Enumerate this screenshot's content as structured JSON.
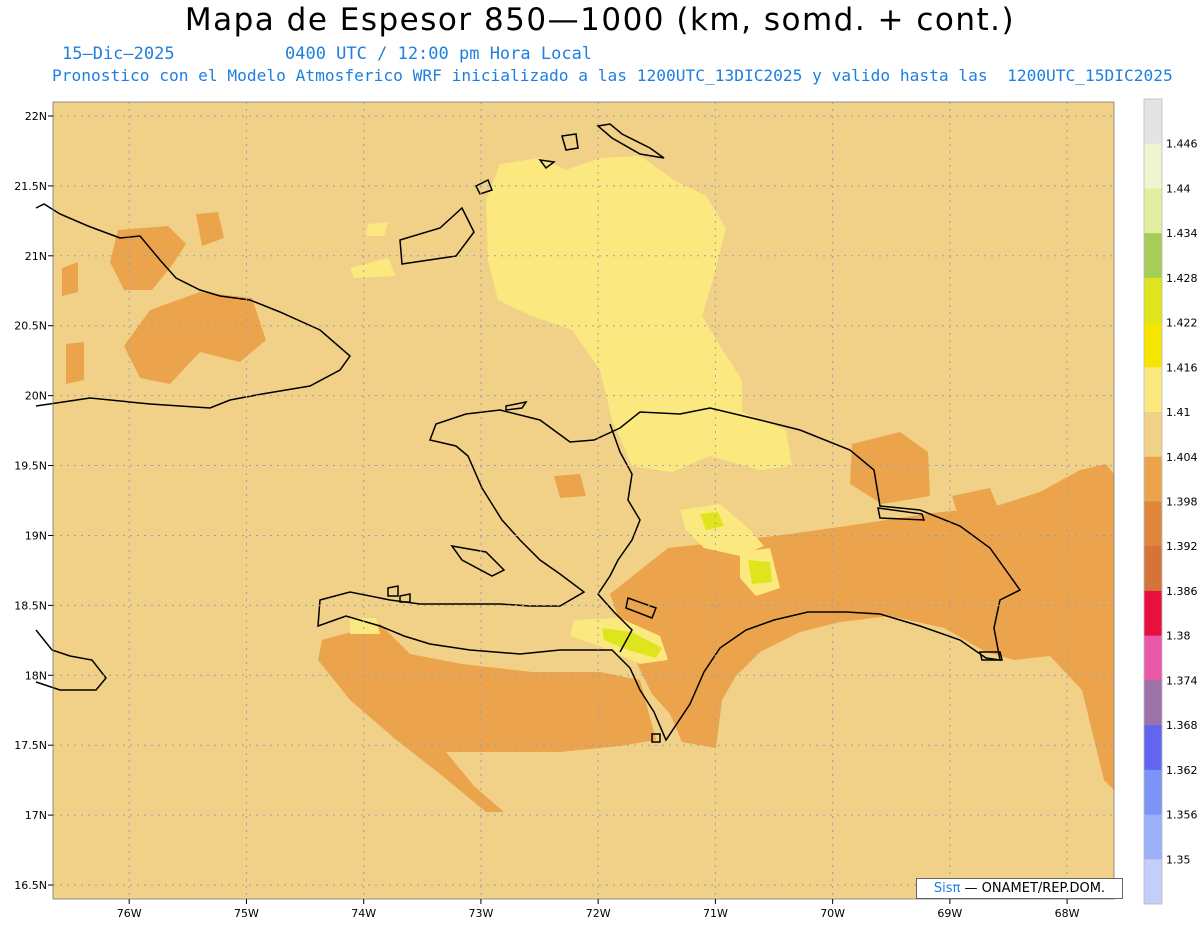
{
  "header": {
    "title": "Mapa de Espesor 850—1000 (km, somd. + cont.)",
    "date": "15—Dic—2025",
    "time": "0400 UTC / 12:00 pm Hora Local",
    "subtitle": "Pronostico con el Modelo Atmosferico WRF inicializado a las 1200UTC_13DIC2025 y valido hasta las  1200UTC_15DIC2025"
  },
  "axes": {
    "lat_labels": [
      "22N",
      "21.5N",
      "21N",
      "20.5N",
      "20N",
      "19.5N",
      "19N",
      "18.5N",
      "18N",
      "17.5N",
      "17N",
      "16.5N"
    ],
    "lon_labels": [
      "76W",
      "75W",
      "74W",
      "73W",
      "72W",
      "71W",
      "70W",
      "69W",
      "68W"
    ],
    "lat_range": [
      16.4,
      22.1
    ],
    "lon_range": [
      -76.65,
      -67.6
    ],
    "grid": true
  },
  "colorbar": {
    "labels": [
      "1.446",
      "1.44",
      "1.434",
      "1.428",
      "1.422",
      "1.416",
      "1.41",
      "1.404",
      "1.398",
      "1.392",
      "1.386",
      "1.38",
      "1.374",
      "1.368",
      "1.362",
      "1.356",
      "1.35"
    ],
    "colors": [
      "#e4e4e4",
      "#f0f5cf",
      "#e0f0a0",
      "#a8cc58",
      "#dfe51c",
      "#f5e500",
      "#fbe980",
      "#f1d187",
      "#eca44c",
      "#e0863c",
      "#d4733a",
      "#e8103c",
      "#e85aa8",
      "#9c72a8",
      "#6464f2",
      "#7c94f5",
      "#9ab0f8",
      "#c4cefa"
    ]
  },
  "field_colors": {
    "background": "#f1d187",
    "warm_band": "#fbe980",
    "cool_band": "#eca44c",
    "peak": "#dfe51c"
  },
  "credit": {
    "brand": "Sisπ",
    "text": "— ONAMET/REP.DOM."
  }
}
